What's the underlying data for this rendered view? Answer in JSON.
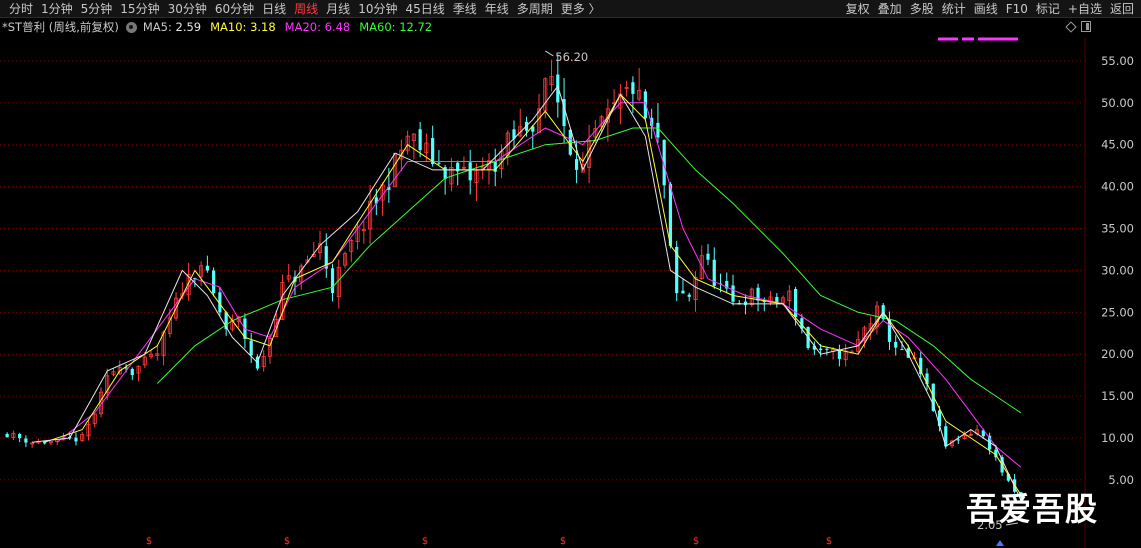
{
  "toolbar": {
    "periods": [
      "分时",
      "1分钟",
      "5分钟",
      "15分钟",
      "30分钟",
      "60分钟",
      "日线",
      "周线",
      "月线",
      "10分钟",
      "45日线",
      "季线",
      "年线",
      "多周期",
      "更多 〉"
    ],
    "active_period": "周线",
    "tools": [
      "复权",
      "叠加",
      "多股",
      "统计",
      "画线",
      "F10",
      "标记",
      "+自选",
      "返回"
    ]
  },
  "legend": {
    "title": "*ST普利 (周线,前复权)",
    "ma5_label": "MA5:",
    "ma5_value": "2.59",
    "ma10_label": "MA10:",
    "ma10_value": "3.18",
    "ma20_label": "MA20:",
    "ma20_value": "6.48",
    "ma60_label": "MA60:",
    "ma60_value": "12.72"
  },
  "watermark": "吾爱吾股",
  "colors": {
    "up": "#ff3b3b",
    "down": "#54ffff",
    "ma5": "#e6e6e6",
    "ma10": "#ffff33",
    "ma20": "#ff33ff",
    "ma60": "#33ff33",
    "axis_text": "#c8c8c8",
    "grid": "#8b0000"
  },
  "chart_data": {
    "type": "candlestick",
    "y_ticks": [
      "55.00",
      "50.00",
      "45.00",
      "40.00",
      "35.00",
      "30.00",
      "25.00",
      "20.00",
      "15.00",
      "10.00",
      "5.00"
    ],
    "ylim": [
      2.0,
      57.5
    ],
    "grid": true,
    "max_label": "56.20",
    "min_label": "2.05",
    "marker_glyph": "$",
    "price_path": [
      [
        0,
        10.5
      ],
      [
        4,
        9.5
      ],
      [
        8,
        9.5
      ],
      [
        12,
        10
      ],
      [
        14,
        13
      ],
      [
        16,
        17
      ],
      [
        18,
        19
      ],
      [
        20,
        18
      ],
      [
        24,
        20
      ],
      [
        28,
        28
      ],
      [
        31,
        31
      ],
      [
        33,
        27
      ],
      [
        35,
        23
      ],
      [
        37,
        24
      ],
      [
        39,
        20
      ],
      [
        40,
        18
      ],
      [
        42,
        22
      ],
      [
        44,
        28
      ],
      [
        47,
        30
      ],
      [
        50,
        33
      ],
      [
        52,
        28
      ],
      [
        55,
        33
      ],
      [
        58,
        37
      ],
      [
        61,
        41
      ],
      [
        64,
        46
      ],
      [
        67,
        44
      ],
      [
        70,
        42
      ],
      [
        74,
        41
      ],
      [
        78,
        43
      ],
      [
        80,
        45
      ],
      [
        84,
        48
      ],
      [
        87,
        53
      ],
      [
        90,
        45
      ],
      [
        92,
        42
      ],
      [
        94,
        46
      ],
      [
        97,
        49
      ],
      [
        100,
        52
      ],
      [
        102,
        48
      ],
      [
        104,
        45
      ],
      [
        105,
        40
      ],
      [
        106,
        32
      ],
      [
        107,
        27
      ],
      [
        109,
        27
      ],
      [
        111,
        32
      ],
      [
        113,
        29
      ],
      [
        116,
        26
      ],
      [
        119,
        27
      ],
      [
        122,
        26
      ],
      [
        125,
        27
      ],
      [
        128,
        21
      ],
      [
        130,
        20
      ],
      [
        133,
        20
      ],
      [
        135,
        20
      ],
      [
        137,
        23
      ],
      [
        139,
        25
      ],
      [
        141,
        22
      ],
      [
        143,
        20
      ],
      [
        145,
        19
      ],
      [
        147,
        16
      ],
      [
        149,
        11
      ],
      [
        150,
        9
      ],
      [
        152,
        10
      ],
      [
        155,
        11
      ],
      [
        157,
        9
      ],
      [
        159,
        6
      ],
      [
        160,
        4.5
      ],
      [
        161,
        3.5
      ],
      [
        162,
        2.6
      ]
    ],
    "series": [
      {
        "name": "MA60",
        "values": [
          [
            24,
            16.5
          ],
          [
            30,
            21
          ],
          [
            36,
            24
          ],
          [
            44,
            26.5
          ],
          [
            52,
            28
          ],
          [
            58,
            33
          ],
          [
            64,
            37
          ],
          [
            70,
            41
          ],
          [
            78,
            43
          ],
          [
            86,
            45
          ],
          [
            94,
            45.5
          ],
          [
            100,
            47
          ],
          [
            104,
            47
          ],
          [
            110,
            42
          ],
          [
            116,
            38
          ],
          [
            124,
            32
          ],
          [
            130,
            27
          ],
          [
            136,
            25
          ],
          [
            142,
            24
          ],
          [
            148,
            21
          ],
          [
            154,
            17
          ],
          [
            160,
            14
          ],
          [
            162,
            13
          ]
        ]
      },
      {
        "name": "MA20",
        "values": [
          [
            8,
            9.5
          ],
          [
            14,
            13
          ],
          [
            20,
            19
          ],
          [
            26,
            25
          ],
          [
            30,
            29
          ],
          [
            34,
            28
          ],
          [
            38,
            23
          ],
          [
            42,
            22
          ],
          [
            46,
            28
          ],
          [
            52,
            31
          ],
          [
            58,
            37
          ],
          [
            64,
            43
          ],
          [
            70,
            43
          ],
          [
            78,
            43
          ],
          [
            86,
            47
          ],
          [
            92,
            45
          ],
          [
            98,
            50
          ],
          [
            102,
            50
          ],
          [
            106,
            40
          ],
          [
            108,
            35
          ],
          [
            112,
            29
          ],
          [
            118,
            27
          ],
          [
            124,
            26
          ],
          [
            130,
            23
          ],
          [
            136,
            21
          ],
          [
            140,
            24
          ],
          [
            144,
            22
          ],
          [
            150,
            17
          ],
          [
            154,
            13
          ],
          [
            158,
            9
          ],
          [
            162,
            6.5
          ]
        ]
      },
      {
        "name": "MA10",
        "values": [
          [
            6,
            9.5
          ],
          [
            12,
            11
          ],
          [
            18,
            18
          ],
          [
            24,
            21
          ],
          [
            30,
            30
          ],
          [
            34,
            26
          ],
          [
            38,
            22
          ],
          [
            42,
            21
          ],
          [
            46,
            29
          ],
          [
            52,
            31
          ],
          [
            58,
            38
          ],
          [
            64,
            45
          ],
          [
            70,
            42
          ],
          [
            78,
            42
          ],
          [
            86,
            49
          ],
          [
            92,
            43
          ],
          [
            98,
            51
          ],
          [
            102,
            48
          ],
          [
            106,
            33
          ],
          [
            110,
            29
          ],
          [
            116,
            27
          ],
          [
            124,
            26
          ],
          [
            130,
            21
          ],
          [
            136,
            20
          ],
          [
            140,
            25
          ],
          [
            144,
            21
          ],
          [
            150,
            12
          ],
          [
            154,
            10
          ],
          [
            158,
            8
          ],
          [
            162,
            3.2
          ]
        ]
      },
      {
        "name": "MA5",
        "values": [
          [
            4,
            9.5
          ],
          [
            10,
            10
          ],
          [
            16,
            18
          ],
          [
            22,
            20
          ],
          [
            28,
            30
          ],
          [
            32,
            27
          ],
          [
            36,
            22
          ],
          [
            40,
            19
          ],
          [
            44,
            27
          ],
          [
            50,
            33
          ],
          [
            56,
            37
          ],
          [
            62,
            44
          ],
          [
            68,
            42
          ],
          [
            76,
            42
          ],
          [
            84,
            48
          ],
          [
            88,
            52
          ],
          [
            92,
            42
          ],
          [
            98,
            51
          ],
          [
            102,
            46
          ],
          [
            106,
            30
          ],
          [
            110,
            28
          ],
          [
            116,
            26
          ],
          [
            124,
            26
          ],
          [
            130,
            20
          ],
          [
            136,
            21
          ],
          [
            140,
            25
          ],
          [
            144,
            20
          ],
          [
            148,
            14
          ],
          [
            150,
            9
          ],
          [
            154,
            11
          ],
          [
            158,
            9
          ],
          [
            162,
            2.6
          ]
        ]
      }
    ]
  }
}
